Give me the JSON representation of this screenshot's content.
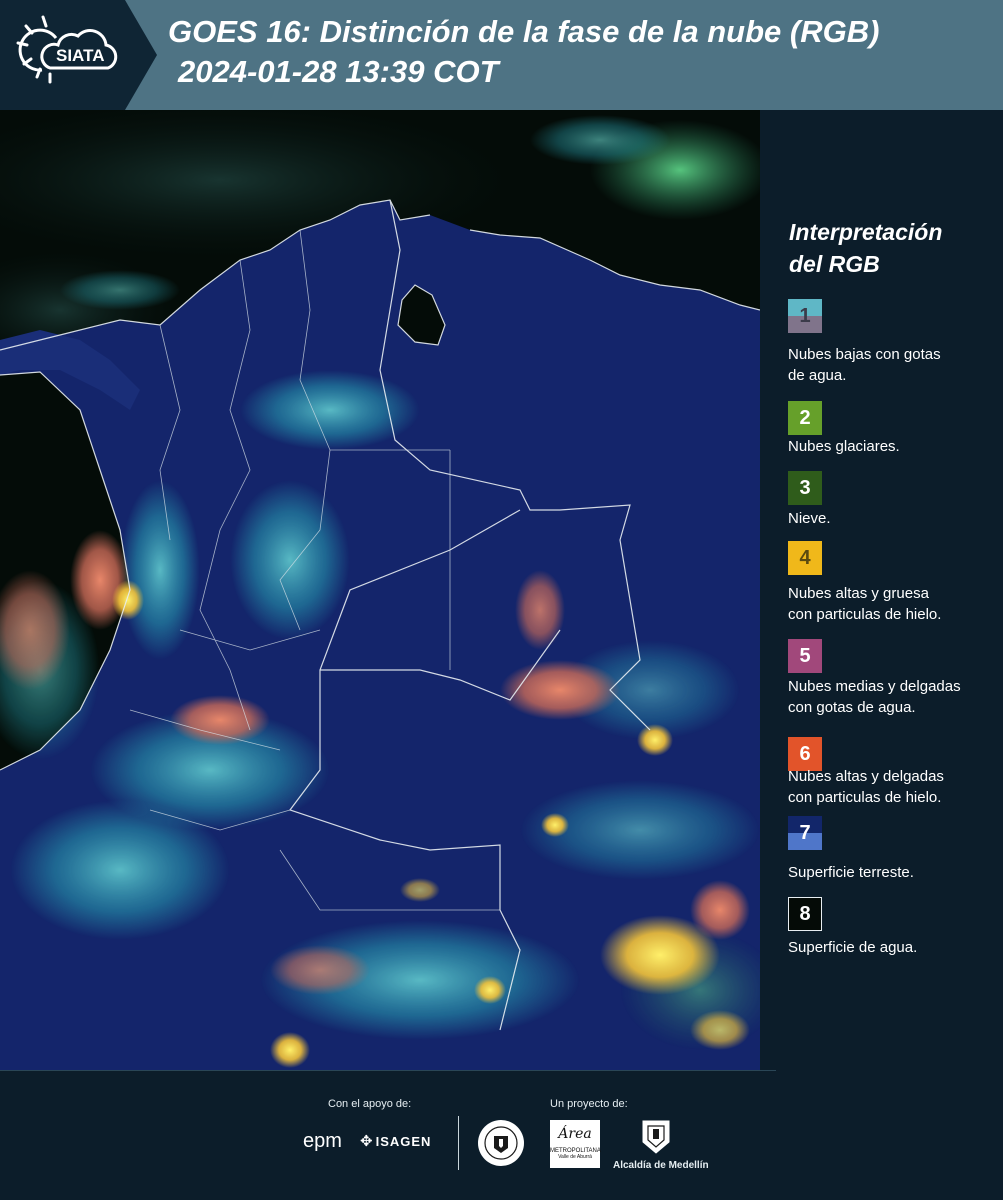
{
  "header": {
    "logo_text": "SIATA",
    "title_line1": "GOES 16: Distinción de la fase de la nube (RGB)",
    "title_line2": "2024-01-28 13:39 COT"
  },
  "legend": {
    "title_line1": "Interpretación",
    "title_line2": "del RGB",
    "items": [
      {
        "number": "1",
        "label_line1": "Nubes bajas con gotas",
        "label_line2": "de agua.",
        "color_top": "#5fb7c6",
        "color_bottom": "#80748b",
        "text_color": "#3b3b4a"
      },
      {
        "number": "2",
        "label_line1": "Nubes glaciares.",
        "label_line2": "",
        "color_top": "#66a02a",
        "color_bottom": "#66a02a",
        "text_color": "#ffffff"
      },
      {
        "number": "3",
        "label_line1": "Nieve.",
        "label_line2": "",
        "color_top": "#2f5c1b",
        "color_bottom": "#2f5c1b",
        "text_color": "#ffffff"
      },
      {
        "number": "4",
        "label_line1": "Nubes altas y gruesa",
        "label_line2": "con particulas de hielo.",
        "color_top": "#f0b81a",
        "color_bottom": "#f0b81a",
        "text_color": "#5a4a10"
      },
      {
        "number": "5",
        "label_line1": "Nubes medias y delgadas",
        "label_line2": "con gotas de agua.",
        "color_top": "#a1487b",
        "color_bottom": "#a1487b",
        "text_color": "#ffffff"
      },
      {
        "number": "6",
        "label_line1": "Nubes altas y delgadas",
        "label_line2": "con particulas de hielo.",
        "color_top": "#e2542a",
        "color_bottom": "#e2542a",
        "text_color": "#ffffff"
      },
      {
        "number": "7",
        "label_line1": "Superficie terreste.",
        "label_line2": "",
        "color_top": "#12266a",
        "color_bottom": "#4f76c9",
        "text_color": "#ffffff"
      },
      {
        "number": "8",
        "label_line1": "Superficie de agua.",
        "label_line2": "",
        "color_top": "#050b07",
        "color_bottom": "#050b07",
        "text_color": "#ffffff"
      }
    ]
  },
  "footer": {
    "support_label": "Con el apoyo de:",
    "project_label": "Un proyecto de:",
    "epm": "epm",
    "isagen": "ISAGEN",
    "area_metro_name": "Área",
    "area_metro_sub1": "METROPOLITANA",
    "area_metro_sub2": "Valle de Aburrá",
    "alcaldia": "Alcaldía de Medellín"
  },
  "colors": {
    "header_bg": "#4e7384",
    "page_bg": "#0c1d2a",
    "land": "#14256b",
    "ocean": "#040c08"
  }
}
